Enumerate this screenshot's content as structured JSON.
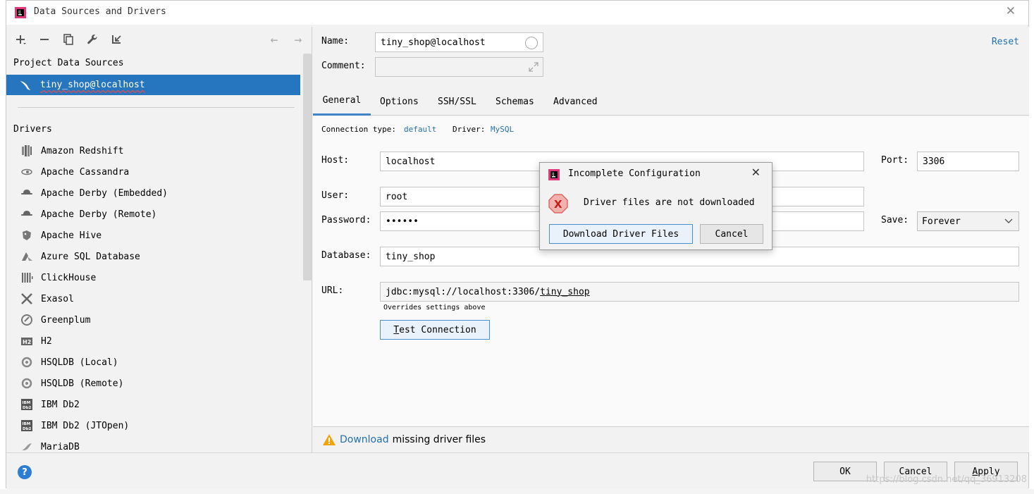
{
  "window": {
    "title": "Data Sources and Drivers"
  },
  "left": {
    "project_label": "Project Data Sources",
    "selected_source": "tiny_shop@localhost",
    "drivers_label": "Drivers",
    "drivers": [
      {
        "name": "Amazon Redshift",
        "icon": "redshift-icon"
      },
      {
        "name": "Apache Cassandra",
        "icon": "cassandra-icon"
      },
      {
        "name": "Apache Derby (Embedded)",
        "icon": "derby-icon"
      },
      {
        "name": "Apache Derby (Remote)",
        "icon": "derby-icon"
      },
      {
        "name": "Apache Hive",
        "icon": "hive-icon"
      },
      {
        "name": "Azure SQL Database",
        "icon": "azure-icon"
      },
      {
        "name": "ClickHouse",
        "icon": "clickhouse-icon"
      },
      {
        "name": "Exasol",
        "icon": "exasol-icon"
      },
      {
        "name": "Greenplum",
        "icon": "greenplum-icon"
      },
      {
        "name": "H2",
        "icon": "h2-icon"
      },
      {
        "name": "HSQLDB (Local)",
        "icon": "hsqldb-icon"
      },
      {
        "name": "HSQLDB (Remote)",
        "icon": "hsqldb-icon"
      },
      {
        "name": "IBM Db2",
        "icon": "db2-icon"
      },
      {
        "name": "IBM Db2 (JTOpen)",
        "icon": "db2-icon"
      },
      {
        "name": "MariaDB",
        "icon": "mariadb-icon"
      }
    ]
  },
  "form": {
    "name_label": "Name:",
    "name_value": "tiny_shop@localhost",
    "comment_label": "Comment:",
    "comment_value": "",
    "reset_label": "Reset",
    "tabs": [
      "General",
      "Options",
      "SSH/SSL",
      "Schemas",
      "Advanced"
    ],
    "conn_type_label": "Connection type:",
    "conn_type_value": "default",
    "driver_label": "Driver:",
    "driver_value": "MySQL",
    "host_label": "Host:",
    "host_value": "localhost",
    "port_label": "Port:",
    "port_value": "3306",
    "user_label": "User:",
    "user_value": "root",
    "password_label": "Password:",
    "password_value": "••••••",
    "save_label": "Save:",
    "save_value": "Forever",
    "database_label": "Database:",
    "database_value": "tiny_shop",
    "url_label": "URL:",
    "url_prefix": "jdbc:mysql://localhost:3306/",
    "url_db": "tiny_shop",
    "url_note": "Overrides settings above",
    "test_first": "T",
    "test_rest": "est Connection"
  },
  "status": {
    "download_link": "Download",
    "message": "missing driver files"
  },
  "buttons": {
    "ok": "OK",
    "cancel": "Cancel",
    "apply_first": "A",
    "apply_rest": "pply"
  },
  "watermark": "https://blog.csdn.net/qq_36913208",
  "modal": {
    "title": "Incomplete Configuration",
    "message": "Driver files are not downloaded",
    "download_button": "Download Driver Files",
    "cancel_button": "Cancel"
  },
  "colors": {
    "selection": "#2675bf",
    "link": "#2470b3",
    "accent_tab": "#4083c9",
    "error": "#d9534f",
    "warning": "#f0a30a"
  }
}
